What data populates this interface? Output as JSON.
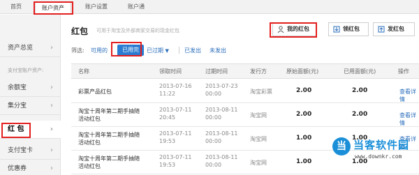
{
  "top_tabs": [
    {
      "label": "首页",
      "active": false
    },
    {
      "label": "账户资产",
      "active": true
    },
    {
      "label": "账户设置",
      "active": false
    },
    {
      "label": "账户通",
      "active": false
    }
  ],
  "sidebar": {
    "items": [
      {
        "label": "资产总览"
      },
      {
        "label": "余额宝"
      },
      {
        "label": "集分宝"
      },
      {
        "label": "红 包"
      },
      {
        "label": "支付宝卡"
      },
      {
        "label": "优惠券"
      }
    ],
    "section_label": "支付宝账户资产:"
  },
  "main": {
    "title": "红包",
    "subtitle": "可用于淘宝及外部商家交易的现金红包",
    "buttons": {
      "my": "我的红包",
      "get": "领红包",
      "send": "发红包"
    }
  },
  "filter": {
    "label": "筛选:",
    "options": [
      {
        "label": "可用的",
        "active": false
      },
      {
        "label": "已用完",
        "active": true
      },
      {
        "label": "已过期",
        "active": false,
        "dropdown": true
      },
      {
        "label": "已发出",
        "active": false
      },
      {
        "label": "未发出",
        "active": false
      }
    ]
  },
  "table": {
    "headers": [
      "名称",
      "领取时间",
      "过期时间",
      "发行方",
      "原始面额(元)",
      "已用面额(元)",
      "操作"
    ],
    "rows": [
      {
        "name": "彩票产品红包",
        "recv_date": "2013-07-16",
        "recv_time": "11:22",
        "exp_date": "2013-07-23",
        "exp_time": "00:00",
        "issuer": "淘宝彩票",
        "original": "2.00",
        "used": "2.00",
        "action": "查看详情"
      },
      {
        "name": "淘宝十周年第二期手抽随活动红包",
        "recv_date": "2013-07-11",
        "recv_time": "20:45",
        "exp_date": "2013-08-11",
        "exp_time": "00:00",
        "issuer": "淘宝网",
        "original": "2.00",
        "used": "2.00",
        "action": "查看详情"
      },
      {
        "name": "淘宝十周年第二期手抽随活动红包",
        "recv_date": "2013-07-11",
        "recv_time": "19:53",
        "exp_date": "2013-08-11",
        "exp_time": "00:00",
        "issuer": "淘宝网",
        "original": "1.00",
        "used": "1.00",
        "action": "查看详情"
      },
      {
        "name": "淘宝十周年第二期手抽随活动红包",
        "recv_date": "2013-07-11",
        "recv_time": "19:53",
        "exp_date": "2013-08-11",
        "exp_time": "00:00",
        "issuer": "淘宝网",
        "original": "1.00",
        "used": "1.00",
        "action": ""
      }
    ]
  },
  "watermark": {
    "logo_char": "当",
    "text": "当客软件园",
    "url": "www.downkr.com"
  },
  "colors": {
    "accent": "#2a7bd1",
    "highlight_box": "#e41e1e",
    "link": "#2a6ebb"
  }
}
